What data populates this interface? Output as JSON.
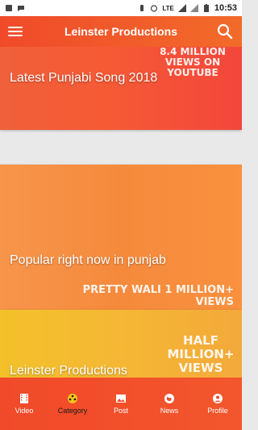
{
  "status_bar": {
    "network": "LTE",
    "time": "10:53"
  },
  "app_bar": {
    "title": "Leinster Productions",
    "menu_icon": "hamburger-menu-icon",
    "search_icon": "search-icon"
  },
  "feed": {
    "cards": [
      {
        "label": "Latest Punjabi Song 2018",
        "overlay_text": "8.4 MILLION VIEWS ON YOUTUBE"
      },
      {
        "label": "Popular right now in punjab",
        "overlay_text": "PRETTY WALI 1 MILLION+ VIEWS"
      },
      {
        "label": "Leinster Productions",
        "overlay_text": "HALF MILLION+ VIEWS"
      }
    ]
  },
  "bottom_nav": {
    "items": [
      {
        "label": "Video",
        "icon": "film-icon",
        "active": false
      },
      {
        "label": "Category",
        "icon": "reel-icon",
        "active": true
      },
      {
        "label": "Post",
        "icon": "image-icon",
        "active": false
      },
      {
        "label": "News",
        "icon": "globe-icon",
        "active": false
      },
      {
        "label": "Profile",
        "icon": "user-icon",
        "active": false
      }
    ]
  },
  "colors": {
    "primary": "#f04a2a",
    "active_nav_text": "#1a1a1a"
  }
}
